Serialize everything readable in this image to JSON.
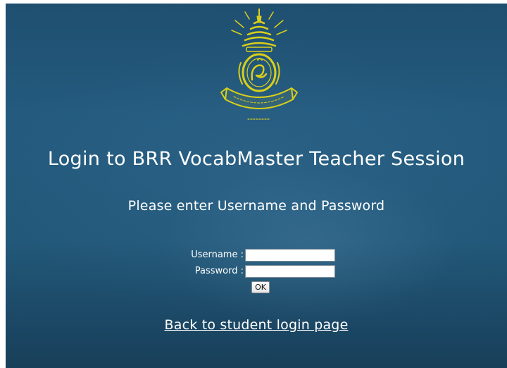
{
  "header": {
    "title": "Login to BRR VocabMaster Teacher Session",
    "subtitle": "Please enter Username and Password"
  },
  "form": {
    "username_label": "Username :",
    "username_value": "",
    "password_label": "Password :",
    "password_value": "",
    "submit_label": "OK"
  },
  "footer": {
    "back_link": "Back to student login page"
  },
  "logo": {
    "icon": "school-emblem-icon",
    "color": "#d9cf1a"
  },
  "colors": {
    "background": "#225879",
    "text": "#ffffff"
  }
}
